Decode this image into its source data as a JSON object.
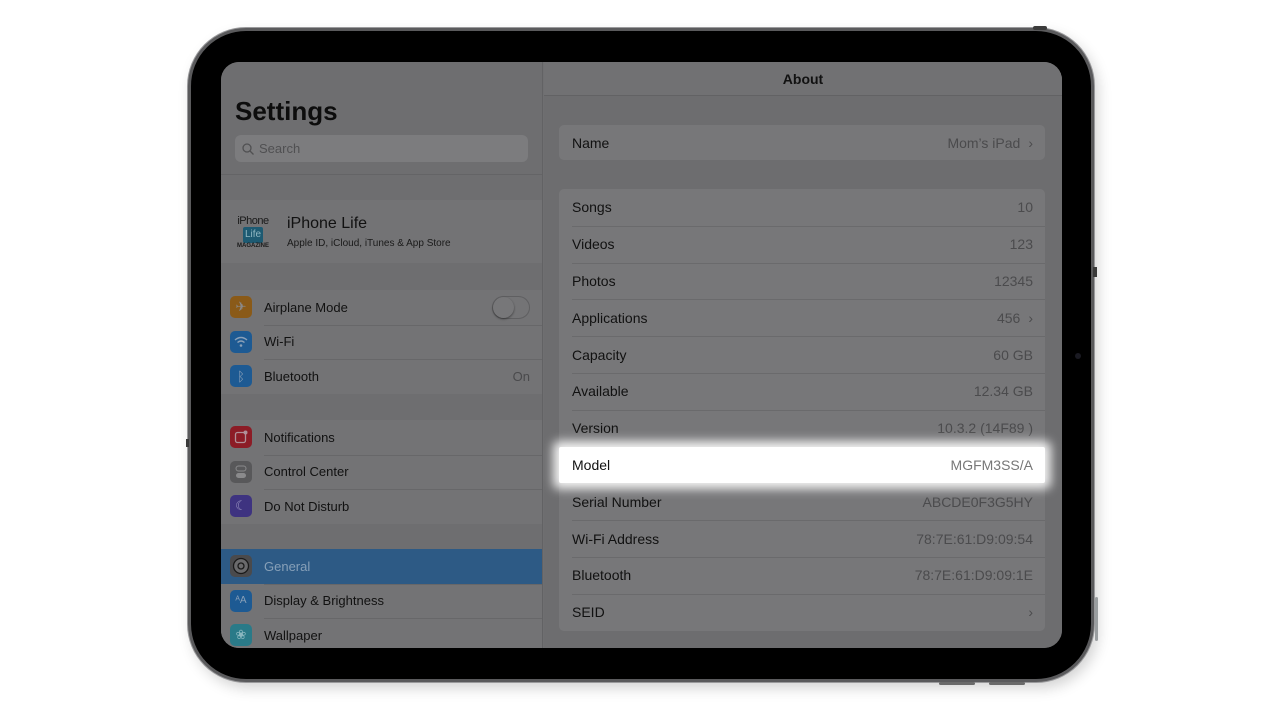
{
  "sidebar": {
    "title": "Settings",
    "search_placeholder": "Search",
    "profile": {
      "logo_top": "iPhone",
      "logo_mid": "Life",
      "logo_bottom": "MAGAZINE",
      "name": "iPhone Life",
      "subtitle": "Apple ID, iCloud, iTunes & App Store"
    },
    "group1": [
      {
        "icon": "airplane-icon",
        "glyph": "✈",
        "color": "#8a5a18",
        "label": "Airplane Mode",
        "toggle": false
      },
      {
        "icon": "wifi-icon",
        "glyph": "◠",
        "color": "#1d5a93",
        "label": "Wi-Fi",
        "value": ""
      },
      {
        "icon": "bluetooth-icon",
        "glyph": "ᛒ",
        "color": "#1d5a93",
        "label": "Bluetooth",
        "value": "On"
      }
    ],
    "group2": [
      {
        "icon": "notifications-icon",
        "glyph": "▢",
        "color": "#8c1c26",
        "label": "Notifications"
      },
      {
        "icon": "control-center-icon",
        "glyph": "⚌",
        "color": "#58585a",
        "label": "Control Center"
      },
      {
        "icon": "do-not-disturb-icon",
        "glyph": "☾",
        "color": "#3e3380",
        "label": "Do Not Disturb"
      }
    ],
    "group3": [
      {
        "icon": "general-gear-icon",
        "glyph": "⚙",
        "color": "#4a4a4c",
        "label": "General",
        "selected": true
      },
      {
        "icon": "display-brightness-icon",
        "glyph": "AA",
        "color": "#1d5a93",
        "label": "Display & Brightness"
      },
      {
        "icon": "wallpaper-icon",
        "glyph": "❀",
        "color": "#2a7a88",
        "label": "Wallpaper"
      }
    ]
  },
  "detail": {
    "title": "About",
    "name_row": {
      "label": "Name",
      "value": "Mom’s iPad",
      "chevron": true
    },
    "rows": [
      {
        "label": "Songs",
        "value": "10"
      },
      {
        "label": "Videos",
        "value": "123"
      },
      {
        "label": "Photos",
        "value": "12345"
      },
      {
        "label": "Applications",
        "value": "456",
        "chevron": true
      },
      {
        "label": "Capacity",
        "value": "60 GB"
      },
      {
        "label": "Available",
        "value": "12.34 GB"
      },
      {
        "label": "Version",
        "value": "10.3.2 (14F89 )"
      },
      {
        "label": "Model",
        "value": "MGFM3SS/A",
        "highlighted": true
      },
      {
        "label": "Serial Number",
        "value": "ABCDE0F3G5HY"
      },
      {
        "label": "Wi-Fi Address",
        "value": "78:7E:61:D9:09:54"
      },
      {
        "label": "Bluetooth",
        "value": "78:7E:61:D9:09:1E"
      },
      {
        "label": "SEID",
        "value": "",
        "chevron": true
      }
    ]
  }
}
